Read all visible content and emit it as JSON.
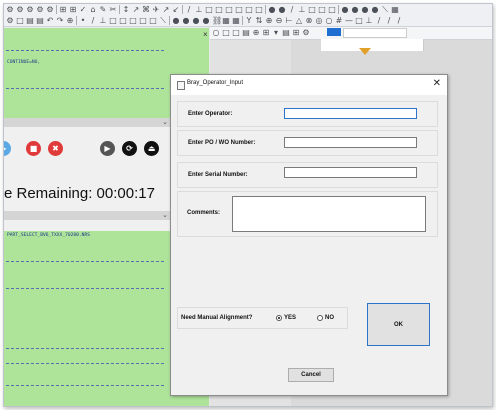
{
  "terminal": {
    "line1": "CONTINUE=NO,",
    "line2": "PART_SELECT_BV6_TXXX_70200.NRS",
    "time_remaining": "e Remaining: 00:00:17",
    "close_glyph": "×"
  },
  "controls": {
    "chevron": "⌄",
    "buttons": [
      {
        "icon": "stop-icon",
        "glyph": "■",
        "color": "#e03a3a"
      },
      {
        "icon": "close-icon",
        "glyph": "✖",
        "color": "#e03a3a"
      },
      {
        "icon": "skip-icon",
        "glyph": "▶",
        "color": "#555555"
      },
      {
        "icon": "cycle-icon",
        "glyph": "⟳",
        "color": "#111111"
      },
      {
        "icon": "end-icon",
        "glyph": "⏏",
        "color": "#111111"
      }
    ]
  },
  "dialog": {
    "title": "Bray_Operator_Input",
    "close": "✕",
    "operator_label": "Enter Operator:",
    "operator_value": "",
    "po_label": "Enter PO / WO Number:",
    "po_value": "",
    "serial_label": "Enter Serial Number:",
    "serial_value": "",
    "comments_label": "Comments:",
    "comments_value": "",
    "alignment_label": "Need Manual Alignment?",
    "yes_label": "YES",
    "no_label": "NO",
    "selected": "YES",
    "ok_label": "OK",
    "cancel_label": "Cancel"
  },
  "colors": {
    "terminal_bg": "#aee39a",
    "accent_blue": "#2b74c7",
    "stop_red": "#e03a3a"
  }
}
